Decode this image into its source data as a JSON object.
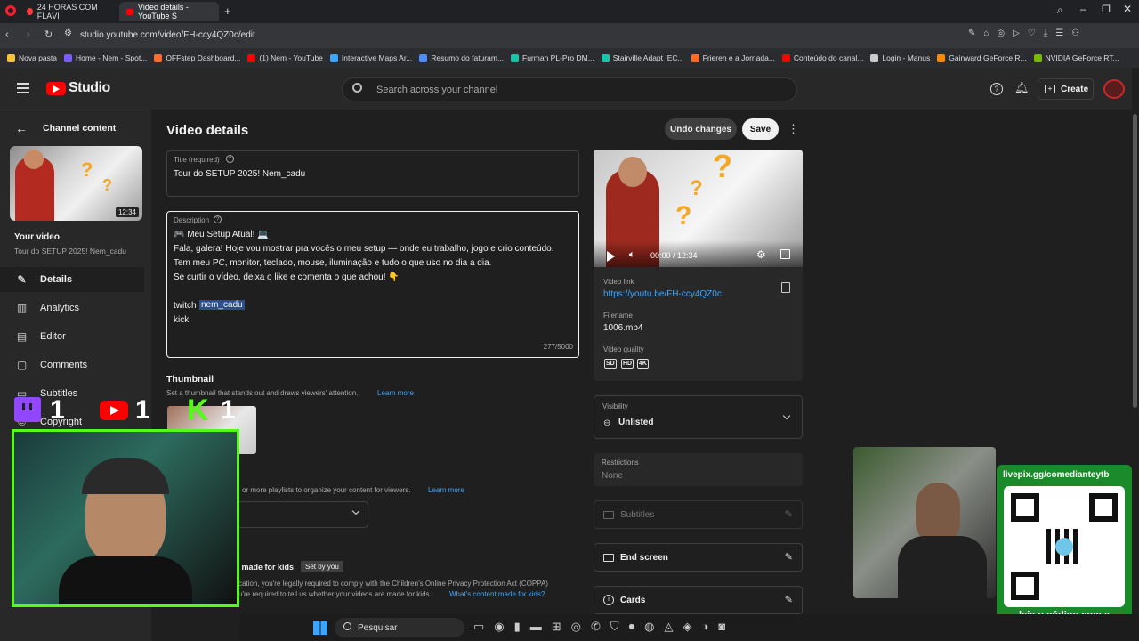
{
  "browser": {
    "tabs": [
      {
        "label": "24 HORAS COM FLÁVI"
      },
      {
        "label": "Video details - YouTube S"
      }
    ],
    "url": "studio.youtube.com/video/FH-ccy4QZ0c/edit",
    "bookmarks": [
      "Nova pasta",
      "Home - Nem - Spot...",
      "OFFstep Dashboard...",
      "(1) Nem - YouTube",
      "Interactive Maps Ar...",
      "Resumo do faturam...",
      "Furman PL-Pro DM...",
      "Stairville Adapt IEC...",
      "Frieren e a Jornada...",
      "Conteúdo do canal...",
      "Login - Manus",
      "Gainward GeForce R...",
      "NVIDIA GeForce RT..."
    ]
  },
  "header": {
    "logo": "Studio",
    "search_placeholder": "Search across your channel",
    "create_label": "Create"
  },
  "sidebar": {
    "back_label": "Channel content",
    "thumb_duration": "12:34",
    "your_video_label": "Your video",
    "your_video_title": "Tour do SETUP 2025! Nem_cadu",
    "items": [
      {
        "label": "Details",
        "icon": "pencil-icon"
      },
      {
        "label": "Analytics",
        "icon": "analytics-icon"
      },
      {
        "label": "Editor",
        "icon": "editor-icon"
      },
      {
        "label": "Comments",
        "icon": "comments-icon"
      },
      {
        "label": "Subtitles",
        "icon": "subtitles-icon"
      },
      {
        "label": "Copyright",
        "icon": "copyright-icon"
      }
    ]
  },
  "page": {
    "title": "Video details",
    "undo_label": "Undo changes",
    "save_label": "Save",
    "title_field": {
      "label": "Title (required)",
      "value": "Tour do SETUP 2025! Nem_cadu"
    },
    "description": {
      "label": "Description",
      "lines": [
        "🎮 Meu Setup Atual! 💻",
        "Fala, galera! Hoje vou mostrar pra vocês o meu setup — onde eu trabalho, jogo e crio conteúdo.",
        "Tem meu PC, monitor, teclado, mouse, iluminação e tudo o que uso no dia a dia.",
        "Se curtir o vídeo, deixa o like e comenta o que achou! 👇"
      ],
      "twitch_word": "twitch",
      "twitch_handle": "nem_cadu",
      "kick_line": "kick",
      "count": "277/5000"
    },
    "thumbnail": {
      "heading": "Thumbnail",
      "desc": "Set a thumbnail that stands out and draws viewers' attention.",
      "learn_more": "Learn more"
    },
    "playlists": {
      "desc": "or more playlists to organize your content for viewers.",
      "learn_more": "Learn more"
    },
    "audience": {
      "made_for_kids": "t made for kids",
      "set_by_you": "Set by you",
      "line1": "cation, you're legally required to comply with the Children's Online Privacy Protection Act (COPPA)",
      "line2": "u're required to tell us whether your videos are made for kids.",
      "link": "What's content made for kids?"
    }
  },
  "video_panel": {
    "time": "00:00 / 12:34",
    "link_label": "Video link",
    "link": "https://youtu.be/FH-ccy4QZ0c",
    "filename_label": "Filename",
    "filename": "1006.mp4",
    "quality_label": "Video quality",
    "qualities": [
      "SD",
      "HD",
      "4K"
    ],
    "visibility_label": "Visibility",
    "visibility": "Unlisted",
    "restrictions_label": "Restrictions",
    "restrictions": "None",
    "subtitles": "Subtitles",
    "end_screen": "End screen",
    "cards": "Cards"
  },
  "overlay": {
    "twitch_count": "1",
    "youtube_count": "1",
    "kick_count": "1",
    "qr_url": "livepix.gg/comedianteytb",
    "qr_caption": "leia o código com a câmera do celular."
  },
  "taskbar": {
    "search": "Pesquisar"
  },
  "colors": {
    "accent": "#3ea6ff",
    "youtube_red": "#ff0000",
    "twitch": "#9146ff",
    "kick": "#53fc18"
  }
}
